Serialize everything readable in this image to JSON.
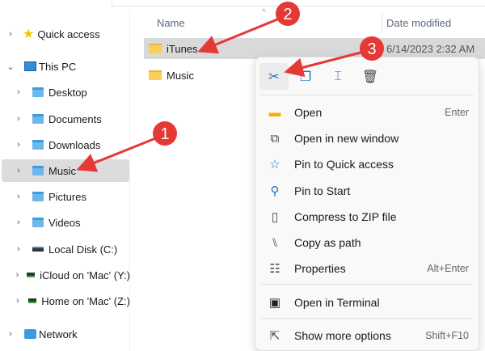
{
  "sidebar": {
    "items": [
      {
        "label": "Quick access",
        "icon": "star-icon",
        "expanded": false
      },
      {
        "label": "This PC",
        "icon": "computer-icon",
        "expanded": true
      },
      {
        "label": "Desktop",
        "icon": "desktop-folder-icon"
      },
      {
        "label": "Documents",
        "icon": "documents-folder-icon"
      },
      {
        "label": "Downloads",
        "icon": "downloads-folder-icon"
      },
      {
        "label": "Music",
        "icon": "music-folder-icon",
        "selected": true
      },
      {
        "label": "Pictures",
        "icon": "pictures-folder-icon"
      },
      {
        "label": "Videos",
        "icon": "videos-folder-icon"
      },
      {
        "label": "Local Disk (C:)",
        "icon": "drive-icon"
      },
      {
        "label": "iCloud on 'Mac' (Y:)",
        "icon": "network-drive-icon"
      },
      {
        "label": "Home on 'Mac' (Z:)",
        "icon": "network-drive-icon"
      },
      {
        "label": "Network",
        "icon": "network-icon"
      }
    ]
  },
  "main": {
    "columns": {
      "name": "Name",
      "date": "Date modified"
    },
    "files": [
      {
        "name": "iTunes",
        "date": "6/14/2023 2:32 AM",
        "selected": true
      },
      {
        "name": "Music",
        "date": ""
      }
    ]
  },
  "context_menu": {
    "toolbar": [
      {
        "name": "cut",
        "glyph": "✂"
      },
      {
        "name": "copy",
        "glyph": "❐"
      },
      {
        "name": "rename",
        "glyph": "⌶"
      },
      {
        "name": "delete",
        "glyph": "🗑"
      }
    ],
    "items": [
      {
        "label": "Open",
        "shortcut": "Enter",
        "glyph": "▬"
      },
      {
        "label": "Open in new window",
        "shortcut": "",
        "glyph": "⧉"
      },
      {
        "label": "Pin to Quick access",
        "shortcut": "",
        "glyph": "☆"
      },
      {
        "label": "Pin to Start",
        "shortcut": "",
        "glyph": "⚲"
      },
      {
        "label": "Compress to ZIP file",
        "shortcut": "",
        "glyph": "▯"
      },
      {
        "label": "Copy as path",
        "shortcut": "",
        "glyph": "⑊"
      },
      {
        "label": "Properties",
        "shortcut": "Alt+Enter",
        "glyph": "☷"
      },
      {
        "label": "Open in Terminal",
        "shortcut": "",
        "glyph": "▣"
      },
      {
        "label": "Show more options",
        "shortcut": "Shift+F10",
        "glyph": "⇱"
      }
    ]
  },
  "annotations": [
    {
      "n": "1"
    },
    {
      "n": "2"
    },
    {
      "n": "3"
    }
  ],
  "colors": {
    "accent": "#1a73c8",
    "annotation": "#e53935",
    "selection": "#d9d9d9"
  }
}
